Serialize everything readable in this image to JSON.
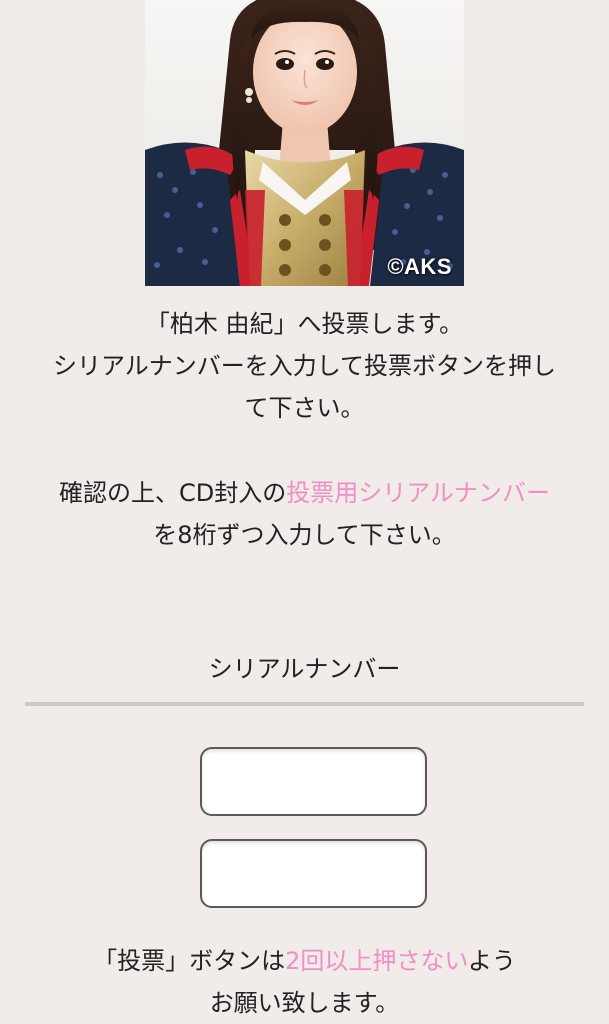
{
  "photo": {
    "copyright": "©AKS"
  },
  "intro": {
    "line1": "「柏木 由紀」へ投票します。",
    "line2": "シリアルナンバーを入力して投票ボタンを押し",
    "line3": "て下さい。"
  },
  "instruction": {
    "line1_before": "確認の上、CD封入の",
    "line1_link": "投票用シリアルナンバー",
    "line2": "を8桁ずつ入力して下さい。"
  },
  "serial": {
    "label": "シリアルナンバー",
    "field1_value": "",
    "field2_value": ""
  },
  "notice": {
    "line1_before": "「投票」ボタンは",
    "line1_highlight": "2回以上押さない",
    "line1_after": "よう",
    "line2": "お願い致します。"
  },
  "colors": {
    "background": "#f1ebea",
    "accent_pink": "#f08fc5",
    "divider": "#cfc8c8"
  }
}
